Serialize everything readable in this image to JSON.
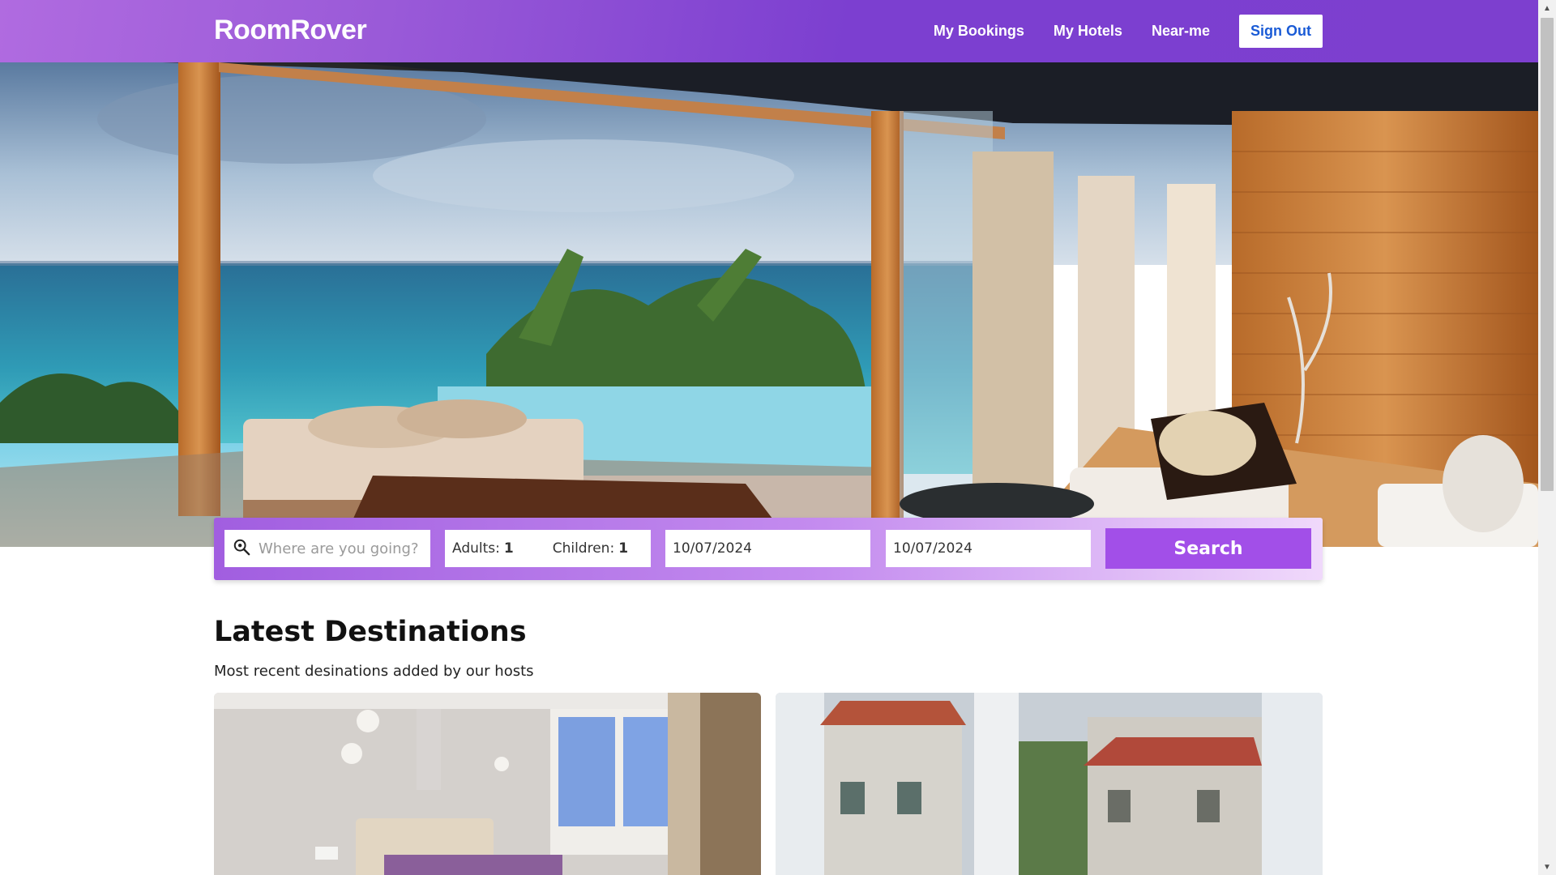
{
  "header": {
    "logo": "RoomRover",
    "nav": [
      "My Bookings",
      "My Hotels",
      "Near-me"
    ],
    "sign_out": "Sign Out"
  },
  "search": {
    "destination_placeholder": "Where are you going?",
    "adults_label": "Adults:",
    "adults_value": "1",
    "children_label": "Children:",
    "children_value": "1",
    "check_in": "10/07/2024",
    "check_out": "10/07/2024",
    "button": "Search"
  },
  "latest": {
    "title": "Latest Destinations",
    "subtitle": "Most recent desinations added by our hosts"
  },
  "colors": {
    "brand": "#7c3fd0",
    "search_button": "#a24fe8",
    "sign_out_text": "#1a5bd6"
  },
  "icons": {
    "search_field": "search-location-icon",
    "scroll_up": "chevron-up-icon",
    "scroll_down": "chevron-down-icon"
  }
}
